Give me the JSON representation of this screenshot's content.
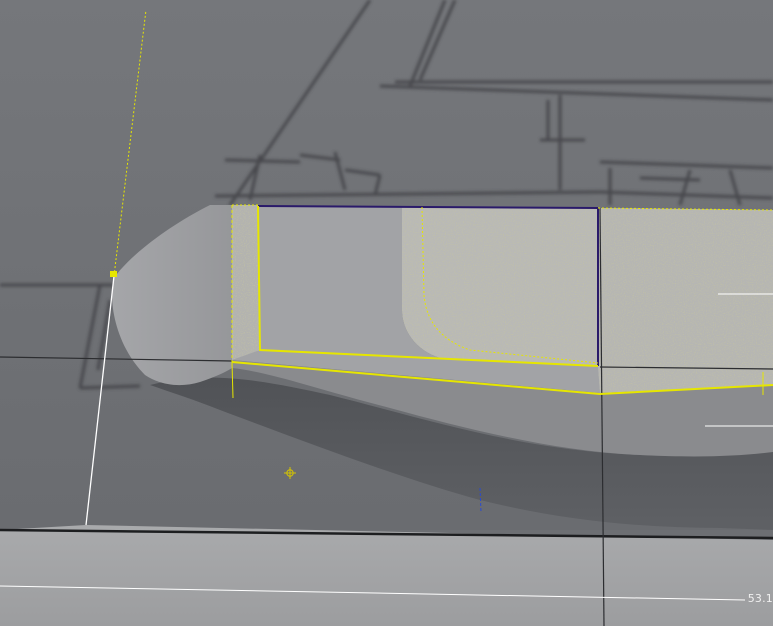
{
  "viewport": {
    "dimension_readout": "53.1"
  },
  "colors": {
    "background": "#6d6f73",
    "floor": "#a3a4a6",
    "selection": "#e6e600",
    "edge_highlight": "#2a1a6a",
    "reference_line": "#ffffff"
  },
  "icons": {
    "snap_target": "crosshair-icon",
    "vertex_handle": "vertex-handle-icon"
  }
}
